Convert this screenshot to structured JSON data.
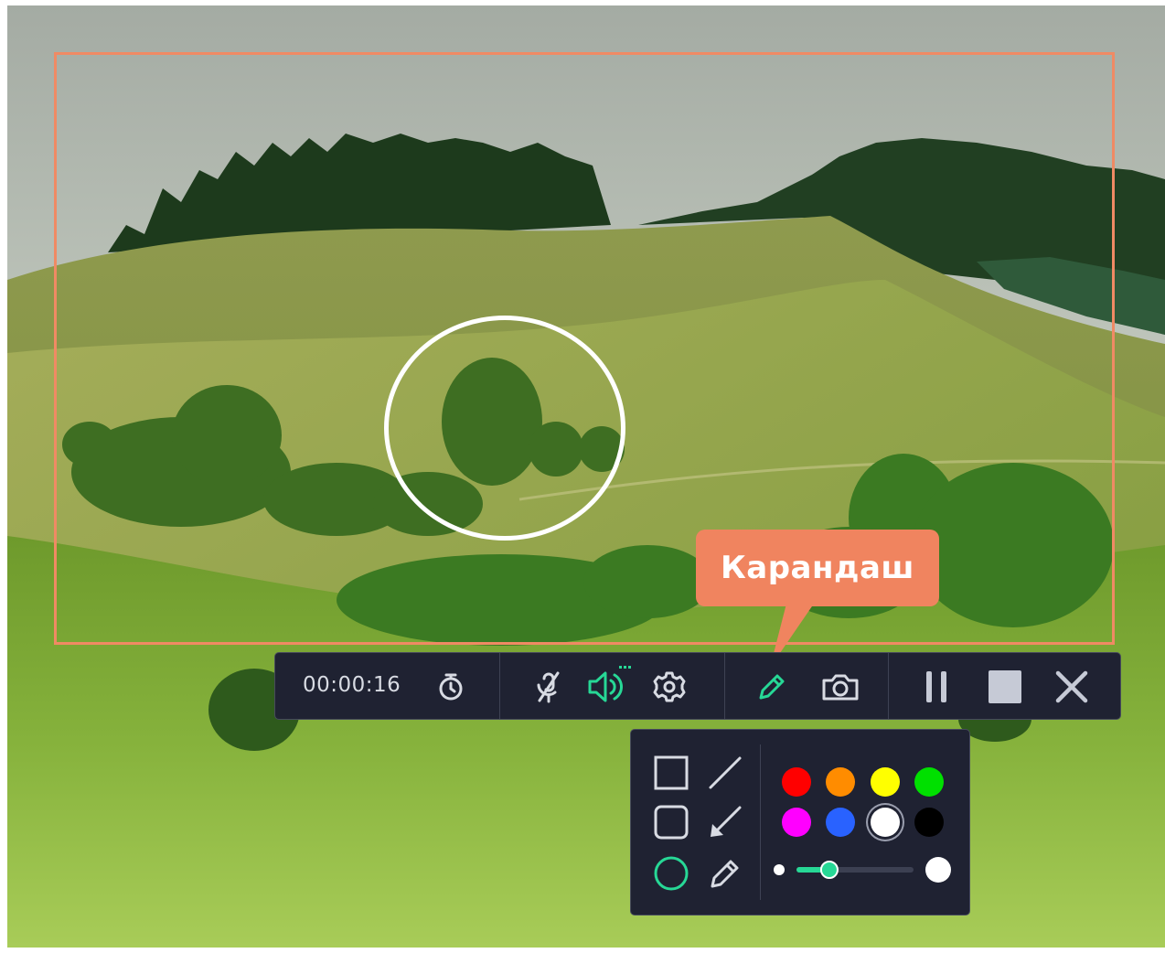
{
  "recording": {
    "elapsed_time": "00:00:16"
  },
  "tooltip": {
    "text": "Карандаш"
  },
  "toolbar": {
    "buttons": [
      {
        "name": "timer",
        "icon": "stopwatch-icon"
      },
      {
        "name": "microphone",
        "icon": "microphone-muted-icon",
        "state": "muted"
      },
      {
        "name": "system-audio",
        "icon": "speaker-icon",
        "state": "active"
      },
      {
        "name": "settings",
        "icon": "gear-icon"
      },
      {
        "name": "draw",
        "icon": "pencil-icon",
        "state": "active"
      },
      {
        "name": "screenshot",
        "icon": "camera-icon"
      },
      {
        "name": "pause",
        "icon": "pause-icon"
      },
      {
        "name": "stop",
        "icon": "stop-icon"
      },
      {
        "name": "close",
        "icon": "close-icon"
      }
    ]
  },
  "drawing_panel": {
    "tools": [
      {
        "name": "rectangle",
        "icon": "rectangle-icon"
      },
      {
        "name": "line",
        "icon": "line-icon"
      },
      {
        "name": "rounded-rectangle",
        "icon": "rounded-rectangle-icon"
      },
      {
        "name": "arrow",
        "icon": "arrow-icon"
      },
      {
        "name": "ellipse",
        "icon": "ellipse-icon",
        "selected": true
      },
      {
        "name": "pencil",
        "icon": "pencil-icon"
      }
    ],
    "colors": [
      "#ff0000",
      "#ff8c00",
      "#ffff00",
      "#00e000",
      "#ff00ff",
      "#2962ff",
      "#ffffff",
      "#000000"
    ],
    "selected_color": "#ffffff",
    "brush_size_fraction": 0.27,
    "accent_color": "#27d896"
  },
  "colors": {
    "capture_frame": "#f08a64",
    "tooltip_bg": "#f0845f",
    "toolbar_bg": "#1f2232",
    "accent": "#27d896",
    "icon": "#d8dbe3"
  }
}
